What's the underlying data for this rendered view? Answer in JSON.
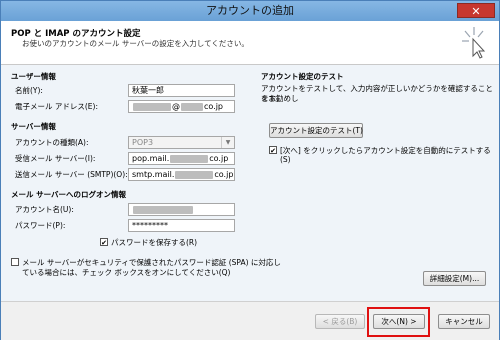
{
  "window": {
    "title": "アカウントの追加",
    "close_label": "✕"
  },
  "header": {
    "title": "POP と IMAP のアカウント設定",
    "subtitle": "お使いのアカウントのメール サーバーの設定を入力してください。"
  },
  "user_info": {
    "section": "ユーザー情報",
    "name_label": "名前(Y):",
    "name_value": "秋葉一郎",
    "email_label": "電子メール アドレス(E):",
    "email_at": "@",
    "email_suffix": "co.jp"
  },
  "server_info": {
    "section": "サーバー情報",
    "type_label": "アカウントの種類(A):",
    "type_value": "POP3",
    "incoming_label": "受信メール サーバー(I):",
    "incoming_prefix": "pop.mail.",
    "incoming_suffix": "co.jp",
    "outgoing_label": "送信メール サーバー (SMTP)(O):",
    "outgoing_prefix": "smtp.mail.",
    "outgoing_suffix": "co.jp"
  },
  "logon_info": {
    "section": "メール サーバーへのログオン情報",
    "account_label": "アカウント名(U):",
    "password_label": "パスワード(P):",
    "password_value": "*********",
    "save_password_label": "パスワードを保存する(R)",
    "spa_label_line1": "メール サーバーがセキュリティで保護されたパスワード認証 (SPA) に対応し",
    "spa_label_line2": "ている場合には、チェック ボックスをオンにしてください(Q)"
  },
  "test": {
    "section": "アカウント設定のテスト",
    "description_line1": "アカウントをテストして、入力内容が正しいかどうかを確認することをお勧めし",
    "description_line2": "ます。",
    "test_button": "アカウント設定のテスト(T)",
    "auto_test_line1": "[次へ] をクリックしたらアカウント設定を自動的にテストする",
    "auto_test_line2": "(S)"
  },
  "buttons": {
    "more_settings": "詳細設定(M)...",
    "back": "< 戻る(B)",
    "next": "次へ(N) >",
    "cancel": "キャンセル"
  },
  "checks": {
    "checked_glyph": "✔"
  },
  "colors": {
    "highlight": "#e01010"
  }
}
